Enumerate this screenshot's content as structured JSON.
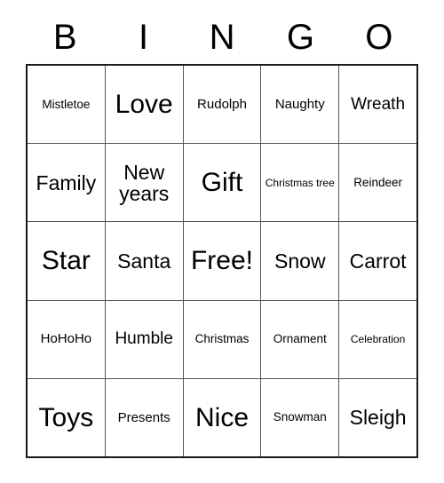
{
  "header": {
    "letters": [
      "B",
      "I",
      "N",
      "G",
      "O"
    ]
  },
  "grid": {
    "rows": [
      [
        {
          "text": "Mistletoe",
          "size": "sm"
        },
        {
          "text": "Love",
          "size": "xxl"
        },
        {
          "text": "Rudolph",
          "size": "md"
        },
        {
          "text": "Naughty",
          "size": "md"
        },
        {
          "text": "Wreath",
          "size": "lg"
        }
      ],
      [
        {
          "text": "Family",
          "size": "xl"
        },
        {
          "text": "New years",
          "size": "xl"
        },
        {
          "text": "Gift",
          "size": "xxl"
        },
        {
          "text": "Christmas tree",
          "size": "xs"
        },
        {
          "text": "Reindeer",
          "size": "sm"
        }
      ],
      [
        {
          "text": "Star",
          "size": "xxl"
        },
        {
          "text": "Santa",
          "size": "xl"
        },
        {
          "text": "Free!",
          "size": "xxl"
        },
        {
          "text": "Snow",
          "size": "xl"
        },
        {
          "text": "Carrot",
          "size": "xl"
        }
      ],
      [
        {
          "text": "HoHoHo",
          "size": "md"
        },
        {
          "text": "Humble",
          "size": "lg"
        },
        {
          "text": "Christmas",
          "size": "sm"
        },
        {
          "text": "Ornament",
          "size": "sm"
        },
        {
          "text": "Celebration",
          "size": "xs"
        }
      ],
      [
        {
          "text": "Toys",
          "size": "xxl"
        },
        {
          "text": "Presents",
          "size": "md"
        },
        {
          "text": "Nice",
          "size": "xxl"
        },
        {
          "text": "Snowman",
          "size": "sm"
        },
        {
          "text": "Sleigh",
          "size": "xl"
        }
      ]
    ]
  },
  "colors": {
    "background": "#ffffff",
    "text": "#000000",
    "outer_border": "#1a1a1a",
    "inner_border": "#555555"
  }
}
